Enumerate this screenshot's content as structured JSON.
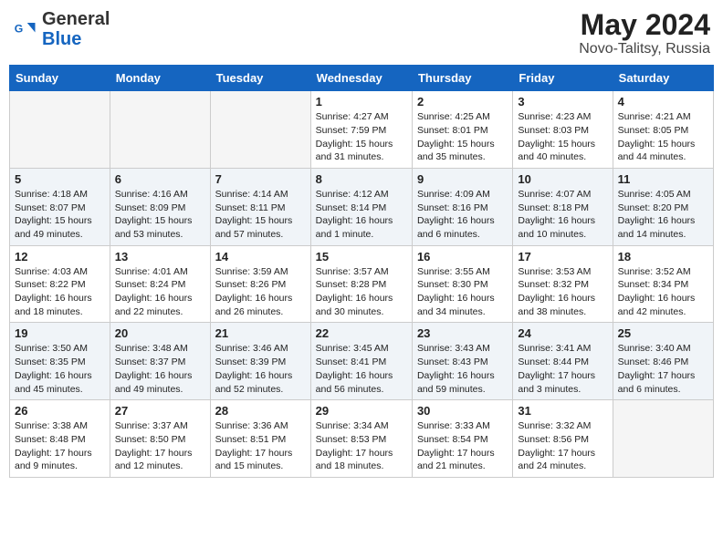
{
  "header": {
    "logo_general": "General",
    "logo_blue": "Blue",
    "month_title": "May 2024",
    "location": "Novo-Talitsy, Russia"
  },
  "weekdays": [
    "Sunday",
    "Monday",
    "Tuesday",
    "Wednesday",
    "Thursday",
    "Friday",
    "Saturday"
  ],
  "weeks": [
    [
      {
        "day": "",
        "info": ""
      },
      {
        "day": "",
        "info": ""
      },
      {
        "day": "",
        "info": ""
      },
      {
        "day": "1",
        "info": "Sunrise: 4:27 AM\nSunset: 7:59 PM\nDaylight: 15 hours\nand 31 minutes."
      },
      {
        "day": "2",
        "info": "Sunrise: 4:25 AM\nSunset: 8:01 PM\nDaylight: 15 hours\nand 35 minutes."
      },
      {
        "day": "3",
        "info": "Sunrise: 4:23 AM\nSunset: 8:03 PM\nDaylight: 15 hours\nand 40 minutes."
      },
      {
        "day": "4",
        "info": "Sunrise: 4:21 AM\nSunset: 8:05 PM\nDaylight: 15 hours\nand 44 minutes."
      }
    ],
    [
      {
        "day": "5",
        "info": "Sunrise: 4:18 AM\nSunset: 8:07 PM\nDaylight: 15 hours\nand 49 minutes."
      },
      {
        "day": "6",
        "info": "Sunrise: 4:16 AM\nSunset: 8:09 PM\nDaylight: 15 hours\nand 53 minutes."
      },
      {
        "day": "7",
        "info": "Sunrise: 4:14 AM\nSunset: 8:11 PM\nDaylight: 15 hours\nand 57 minutes."
      },
      {
        "day": "8",
        "info": "Sunrise: 4:12 AM\nSunset: 8:14 PM\nDaylight: 16 hours\nand 1 minute."
      },
      {
        "day": "9",
        "info": "Sunrise: 4:09 AM\nSunset: 8:16 PM\nDaylight: 16 hours\nand 6 minutes."
      },
      {
        "day": "10",
        "info": "Sunrise: 4:07 AM\nSunset: 8:18 PM\nDaylight: 16 hours\nand 10 minutes."
      },
      {
        "day": "11",
        "info": "Sunrise: 4:05 AM\nSunset: 8:20 PM\nDaylight: 16 hours\nand 14 minutes."
      }
    ],
    [
      {
        "day": "12",
        "info": "Sunrise: 4:03 AM\nSunset: 8:22 PM\nDaylight: 16 hours\nand 18 minutes."
      },
      {
        "day": "13",
        "info": "Sunrise: 4:01 AM\nSunset: 8:24 PM\nDaylight: 16 hours\nand 22 minutes."
      },
      {
        "day": "14",
        "info": "Sunrise: 3:59 AM\nSunset: 8:26 PM\nDaylight: 16 hours\nand 26 minutes."
      },
      {
        "day": "15",
        "info": "Sunrise: 3:57 AM\nSunset: 8:28 PM\nDaylight: 16 hours\nand 30 minutes."
      },
      {
        "day": "16",
        "info": "Sunrise: 3:55 AM\nSunset: 8:30 PM\nDaylight: 16 hours\nand 34 minutes."
      },
      {
        "day": "17",
        "info": "Sunrise: 3:53 AM\nSunset: 8:32 PM\nDaylight: 16 hours\nand 38 minutes."
      },
      {
        "day": "18",
        "info": "Sunrise: 3:52 AM\nSunset: 8:34 PM\nDaylight: 16 hours\nand 42 minutes."
      }
    ],
    [
      {
        "day": "19",
        "info": "Sunrise: 3:50 AM\nSunset: 8:35 PM\nDaylight: 16 hours\nand 45 minutes."
      },
      {
        "day": "20",
        "info": "Sunrise: 3:48 AM\nSunset: 8:37 PM\nDaylight: 16 hours\nand 49 minutes."
      },
      {
        "day": "21",
        "info": "Sunrise: 3:46 AM\nSunset: 8:39 PM\nDaylight: 16 hours\nand 52 minutes."
      },
      {
        "day": "22",
        "info": "Sunrise: 3:45 AM\nSunset: 8:41 PM\nDaylight: 16 hours\nand 56 minutes."
      },
      {
        "day": "23",
        "info": "Sunrise: 3:43 AM\nSunset: 8:43 PM\nDaylight: 16 hours\nand 59 minutes."
      },
      {
        "day": "24",
        "info": "Sunrise: 3:41 AM\nSunset: 8:44 PM\nDaylight: 17 hours\nand 3 minutes."
      },
      {
        "day": "25",
        "info": "Sunrise: 3:40 AM\nSunset: 8:46 PM\nDaylight: 17 hours\nand 6 minutes."
      }
    ],
    [
      {
        "day": "26",
        "info": "Sunrise: 3:38 AM\nSunset: 8:48 PM\nDaylight: 17 hours\nand 9 minutes."
      },
      {
        "day": "27",
        "info": "Sunrise: 3:37 AM\nSunset: 8:50 PM\nDaylight: 17 hours\nand 12 minutes."
      },
      {
        "day": "28",
        "info": "Sunrise: 3:36 AM\nSunset: 8:51 PM\nDaylight: 17 hours\nand 15 minutes."
      },
      {
        "day": "29",
        "info": "Sunrise: 3:34 AM\nSunset: 8:53 PM\nDaylight: 17 hours\nand 18 minutes."
      },
      {
        "day": "30",
        "info": "Sunrise: 3:33 AM\nSunset: 8:54 PM\nDaylight: 17 hours\nand 21 minutes."
      },
      {
        "day": "31",
        "info": "Sunrise: 3:32 AM\nSunset: 8:56 PM\nDaylight: 17 hours\nand 24 minutes."
      },
      {
        "day": "",
        "info": ""
      }
    ]
  ]
}
